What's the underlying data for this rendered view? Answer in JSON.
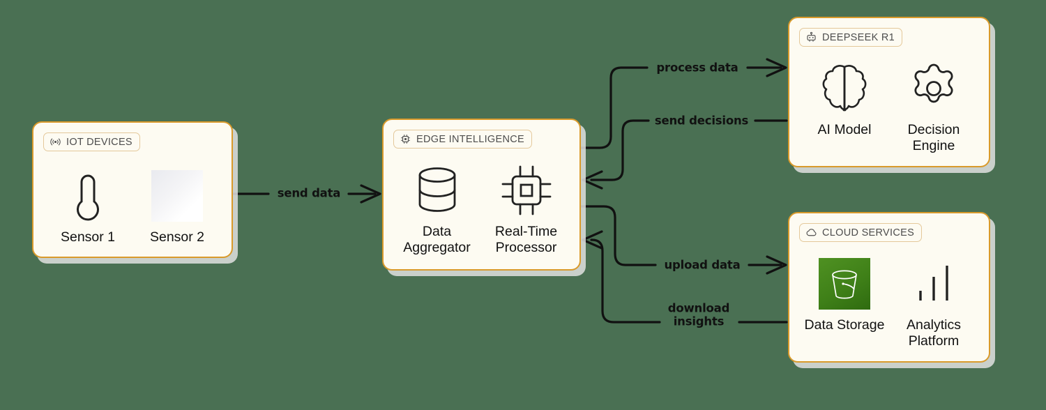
{
  "canvas": {
    "background": "#4a7053",
    "card_fill": "#fdfbf2",
    "card_border": "#d99a2b",
    "badge_border": "#e4c89a",
    "edge_color": "#111111",
    "bucket_green": "#3f8018"
  },
  "cards": [
    {
      "id": "iot-devices",
      "badge": {
        "label": "IOT DEVICES",
        "icon": "wifi-signal-icon"
      },
      "nodes": [
        {
          "label": "Sensor 1",
          "icon": "thermometer-icon"
        },
        {
          "label": "Sensor 2",
          "icon": "broken-image-icon"
        }
      ]
    },
    {
      "id": "edge-intelligence",
      "badge": {
        "label": "EDGE INTELLIGENCE",
        "icon": "cpu-chip-icon"
      },
      "nodes": [
        {
          "label": "Data\nAggregator",
          "icon": "database-cylinder-icon"
        },
        {
          "label": "Real-Time\nProcessor",
          "icon": "processor-chip-icon"
        }
      ]
    },
    {
      "id": "deepseek-r1",
      "badge": {
        "label": "DEEPSEEK R1",
        "icon": "robot-icon"
      },
      "nodes": [
        {
          "label": "AI Model",
          "icon": "brain-icon"
        },
        {
          "label": "Decision\nEngine",
          "icon": "gear-icon"
        }
      ]
    },
    {
      "id": "cloud-services",
      "badge": {
        "label": "CLOUD SERVICES",
        "icon": "cloud-icon"
      },
      "nodes": [
        {
          "label": "Data\nStorage",
          "icon": "s3-bucket-icon"
        },
        {
          "label": "Analytics\nPlatform",
          "icon": "bar-chart-icon"
        }
      ]
    }
  ],
  "edges": [
    {
      "id": "send-data",
      "label": "send data",
      "from": "iot-devices",
      "to": "edge-intelligence"
    },
    {
      "id": "process-data",
      "label": "process data",
      "from": "edge-intelligence",
      "to": "deepseek-r1"
    },
    {
      "id": "send-decisions",
      "label": "send decisions",
      "from": "deepseek-r1",
      "to": "edge-intelligence"
    },
    {
      "id": "upload-data",
      "label": "upload data",
      "from": "edge-intelligence",
      "to": "cloud-services"
    },
    {
      "id": "download-insights",
      "label": "download\ninsights",
      "from": "cloud-services",
      "to": "edge-intelligence"
    }
  ]
}
